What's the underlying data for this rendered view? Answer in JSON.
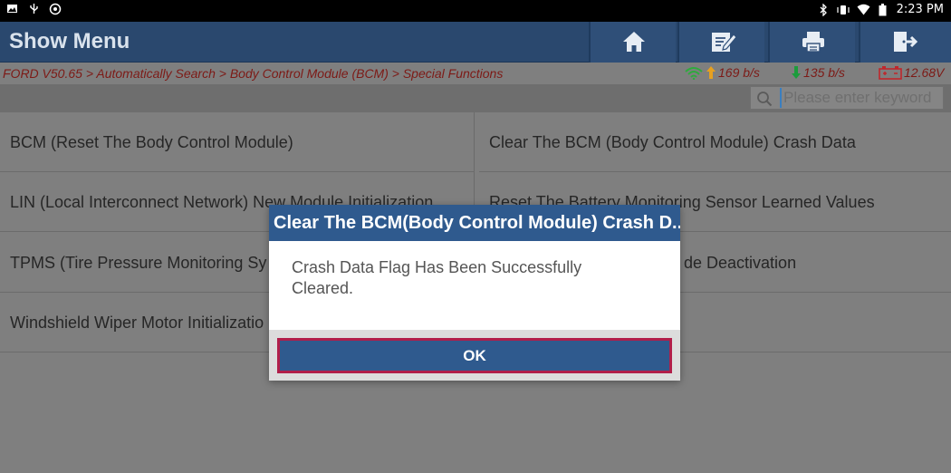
{
  "statusbar": {
    "time": "2:23 PM",
    "left_icons": [
      "gallery-icon",
      "usb-icon",
      "settings-icon"
    ],
    "right_icons": [
      "bluetooth-icon",
      "vibrate-icon",
      "wifi-icon",
      "battery-icon"
    ]
  },
  "header": {
    "title": "Show Menu",
    "tools": [
      "home-icon",
      "edit-icon",
      "print-icon",
      "exit-icon"
    ]
  },
  "breadcrumb": "FORD V50.65 > Automatically Search > Body Control Module (BCM) > Special Functions",
  "stats": {
    "upload": "169 b/s",
    "download": "135 b/s",
    "voltage": "12.68V",
    "colors": {
      "upload_arrow": "#e6a020",
      "download_arrow": "#1c9c3c",
      "wifi": "#2faa3e",
      "battery": "#c0262b"
    }
  },
  "search": {
    "placeholder": "Please enter keyword",
    "value": ""
  },
  "functions": [
    {
      "left": "BCM (Reset The Body Control Module)",
      "right": "Clear The BCM (Body Control Module) Crash Data"
    },
    {
      "left": "LIN (Local Interconnect Network) New Module Initialization",
      "right": "Reset The Battery Monitoring Sensor Learned Values"
    },
    {
      "left": "TPMS (Tire Pressure Monitoring Sy",
      "right": "de Deactivation"
    },
    {
      "left": "Windshield Wiper Motor Initializatio",
      "right": ""
    }
  ],
  "dialog": {
    "title": "Clear The BCM(Body Control Module) Crash D...",
    "message_line1": "Crash Data Flag Has Been Successfully",
    "message_line2": "Cleared.",
    "ok_label": "OK"
  },
  "colors": {
    "header": "#2a486e",
    "dialog_title": "#2f5a8e",
    "ok_border": "#b11e4a",
    "crumb_text": "#7d1a16"
  }
}
